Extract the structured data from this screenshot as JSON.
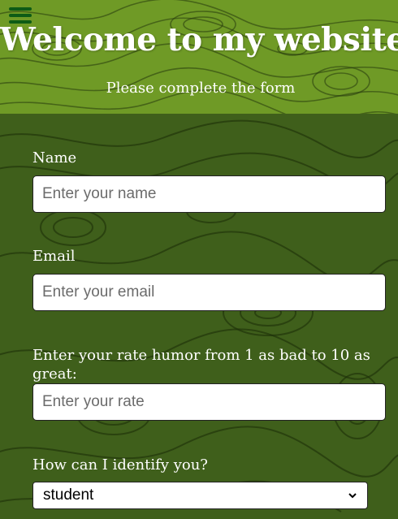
{
  "header": {
    "menu_icon": "hamburger-menu-icon",
    "title": "Welcome to my website",
    "subtitle": "Please complete the form"
  },
  "form": {
    "name": {
      "label": "Name",
      "placeholder": "Enter your name"
    },
    "email": {
      "label": "Email",
      "placeholder": "Enter your email"
    },
    "rate": {
      "label": "Enter your rate humor from 1 as bad to 10 as great:",
      "placeholder": "Enter your rate"
    },
    "identify": {
      "label": "How can I identify you?",
      "selected": "student",
      "icon": "chevron-down-icon"
    }
  },
  "colors": {
    "header_bg": "#6f9a26",
    "body_bg": "#3f5f1b",
    "menu_icon": "#0e5b16",
    "text": "#ffffff"
  }
}
